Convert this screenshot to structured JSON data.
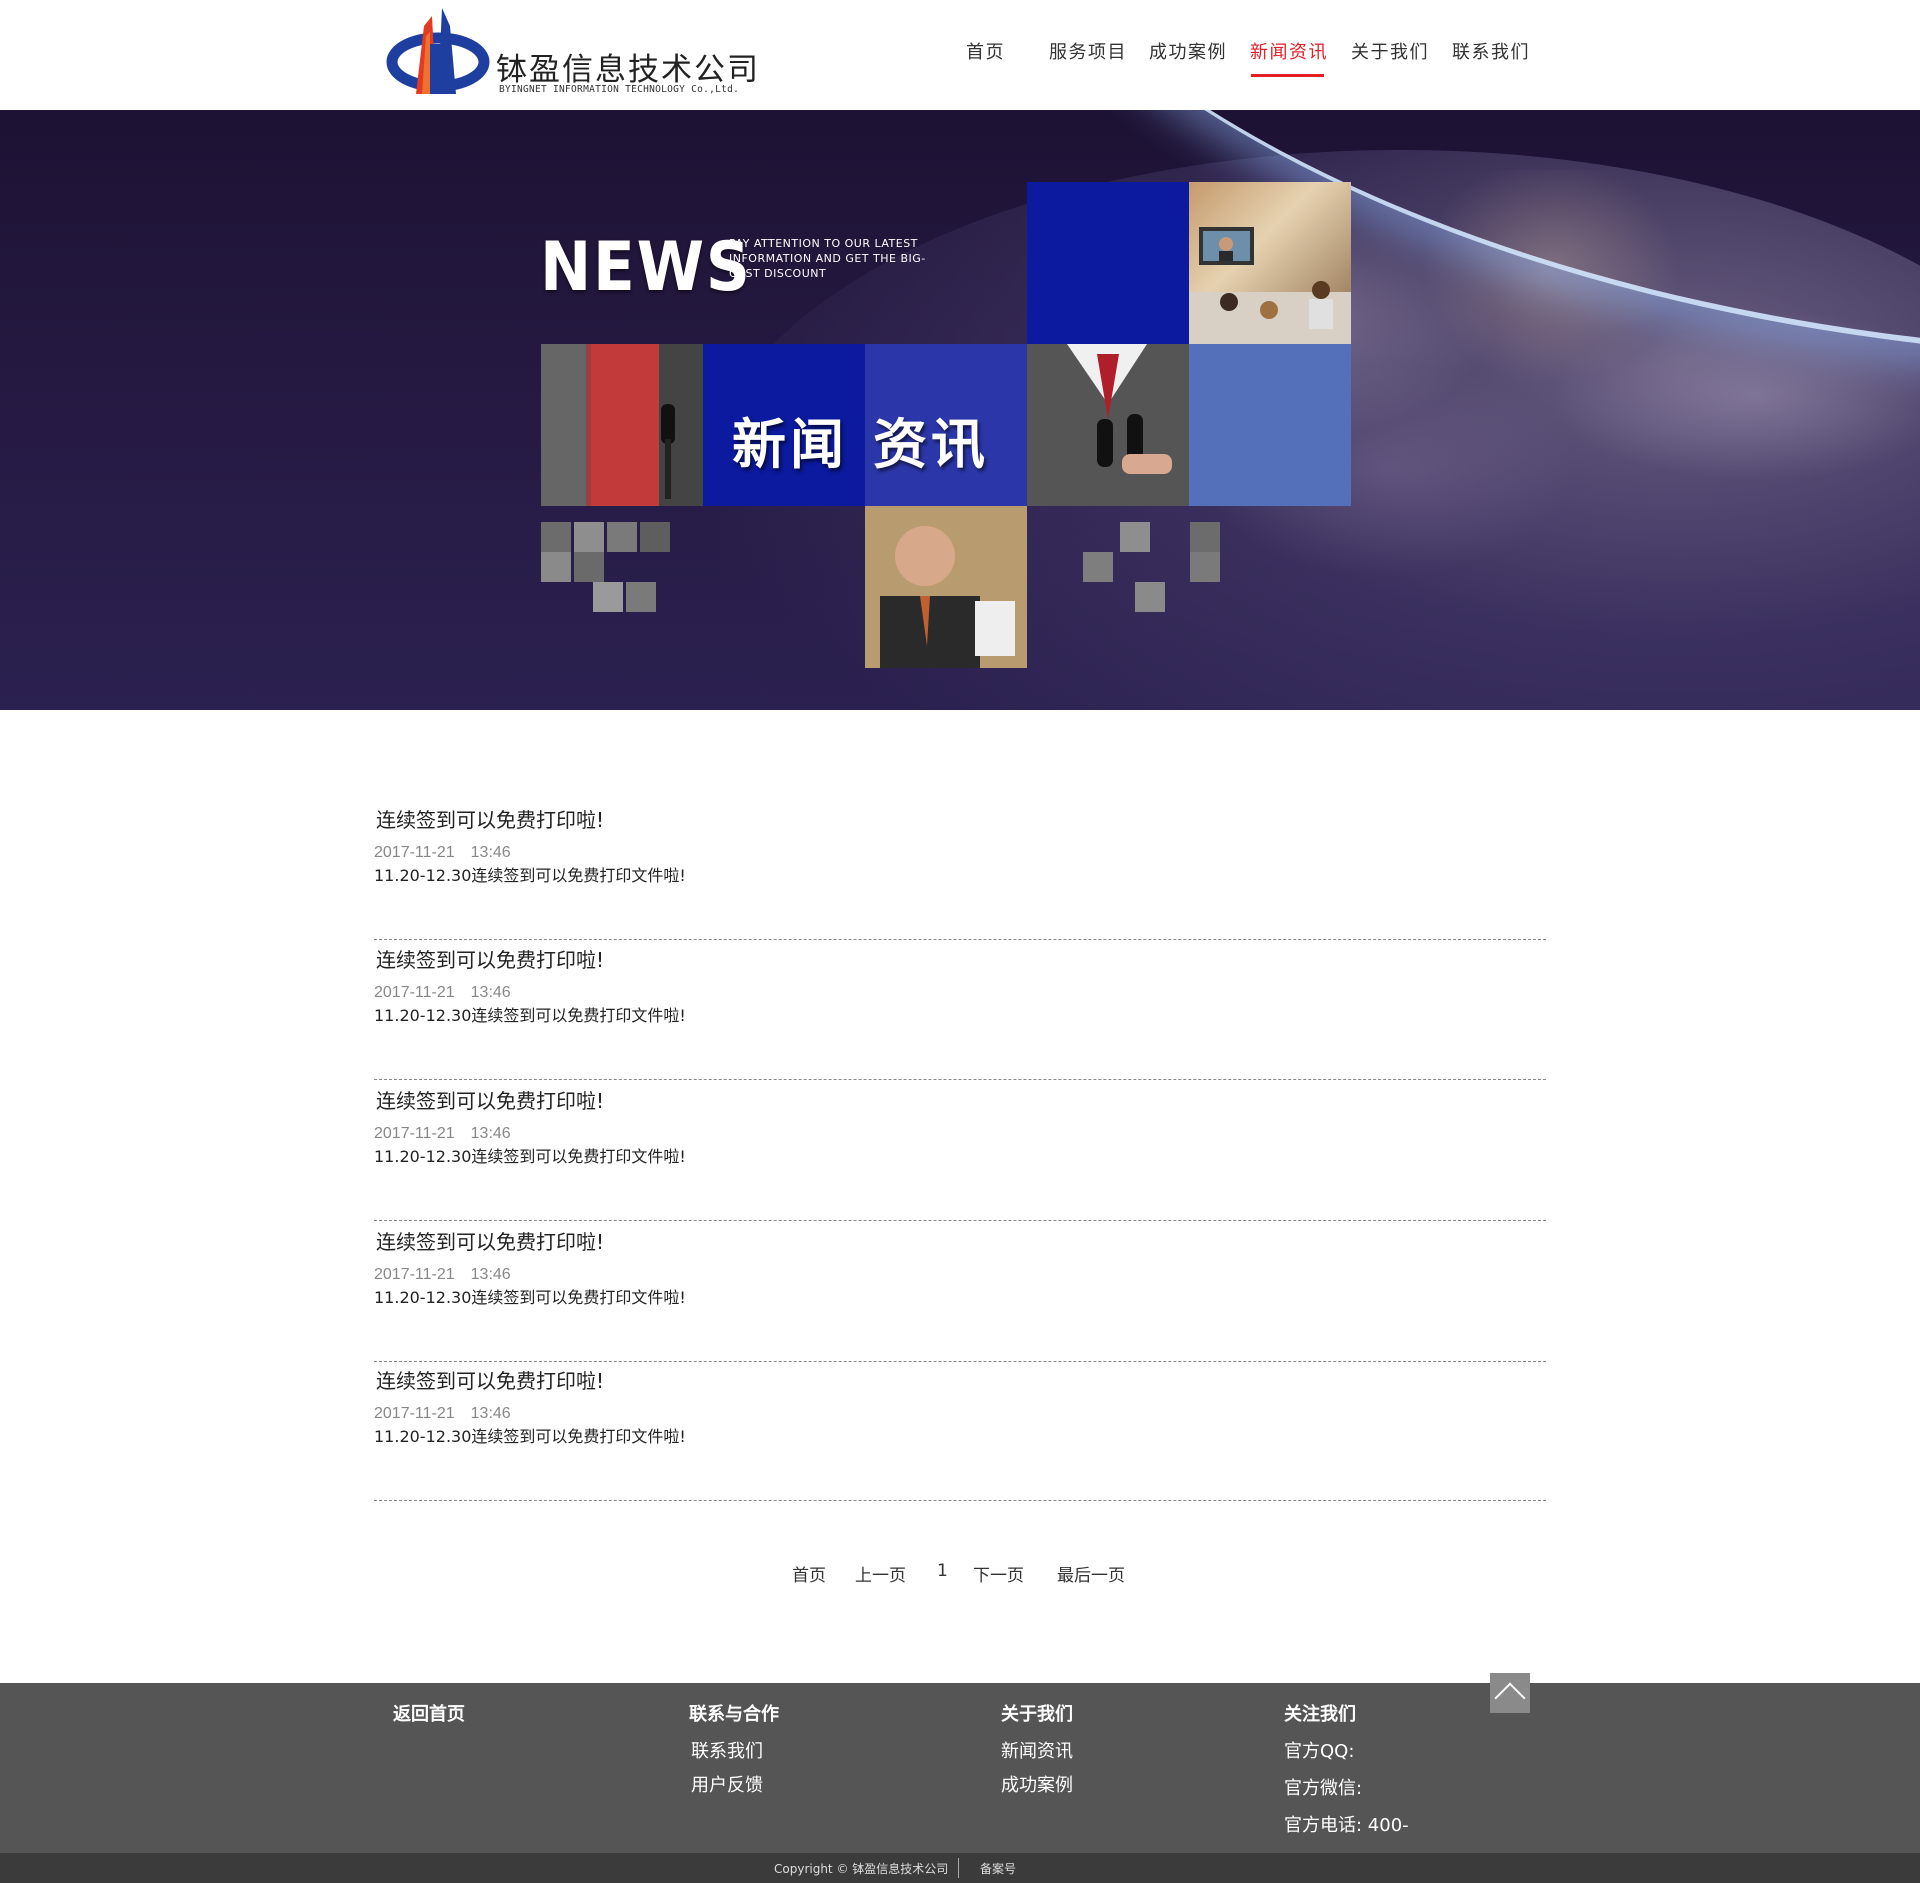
{
  "header": {
    "logo_cn": "钵盈信息技术公司",
    "logo_en": "BYINGNET INFORMATION TECHNOLOGY Co.,Ltd.",
    "nav": [
      {
        "label": "首页"
      },
      {
        "label": "服务项目"
      },
      {
        "label": "成功案例"
      },
      {
        "label": "新闻资讯",
        "active": true
      },
      {
        "label": "关于我们"
      },
      {
        "label": "联系我们"
      }
    ],
    "accent_color": "#e31e25"
  },
  "banner": {
    "news_word": "NEWS",
    "tagline": "PAY ATTENTION TO OUR LATEST INFORMATION AND GET THE BIG-GEST DISCOUNT",
    "title_part1": "新闻",
    "title_part2": "资讯"
  },
  "news": [
    {
      "title": "连续签到可以免费打印啦!",
      "date": "2017-11-21　13:46",
      "desc": "11.20-12.30连续签到可以免费打印文件啦!"
    },
    {
      "title": "连续签到可以免费打印啦!",
      "date": "2017-11-21　13:46",
      "desc": "11.20-12.30连续签到可以免费打印文件啦!"
    },
    {
      "title": "连续签到可以免费打印啦!",
      "date": "2017-11-21　13:46",
      "desc": "11.20-12.30连续签到可以免费打印文件啦!"
    },
    {
      "title": "连续签到可以免费打印啦!",
      "date": "2017-11-21　13:46",
      "desc": "11.20-12.30连续签到可以免费打印文件啦!"
    },
    {
      "title": "连续签到可以免费打印啦!",
      "date": "2017-11-21　13:46",
      "desc": "11.20-12.30连续签到可以免费打印文件啦!"
    }
  ],
  "pager": {
    "first": "首页",
    "prev": "上一页",
    "current": "1",
    "next": "下一页",
    "last": "最后一页"
  },
  "footer": {
    "home": "返回首页",
    "contact_head": "联系与合作",
    "contact_links": [
      "联系我们",
      "用户反馈"
    ],
    "about_head": "关于我们",
    "about_links": [
      "新闻资讯",
      "成功案例"
    ],
    "follow_head": "关注我们",
    "follow_info": [
      "官方QQ:",
      "官方微信:",
      "官方电话: 400-"
    ],
    "copyright": "Copyright © 钵盈信息技术公司",
    "icp": "备案号"
  }
}
